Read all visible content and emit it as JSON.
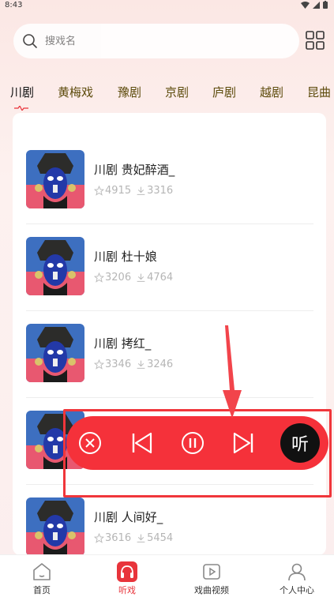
{
  "status": {
    "time": "8:43"
  },
  "search": {
    "placeholder": "搜戏名"
  },
  "tabs": [
    {
      "label": "川剧",
      "active": true
    },
    {
      "label": "黄梅戏",
      "active": false
    },
    {
      "label": "豫剧",
      "active": false
    },
    {
      "label": "京剧",
      "active": false
    },
    {
      "label": "庐剧",
      "active": false
    },
    {
      "label": "越剧",
      "active": false
    },
    {
      "label": "昆曲",
      "active": false
    }
  ],
  "items": [
    {
      "title": "川剧 贵妃醉酒_",
      "favorites": "4915",
      "downloads": "3316"
    },
    {
      "title": "川剧 杜十娘",
      "favorites": "3206",
      "downloads": "4764"
    },
    {
      "title": "川剧 拷红_",
      "favorites": "3346",
      "downloads": "3246"
    },
    {
      "title": "",
      "favorites": "",
      "downloads": ""
    },
    {
      "title": "川剧 人间好_",
      "favorites": "3616",
      "downloads": "5454"
    }
  ],
  "player": {
    "listen_label": "听",
    "accent": "#f5313a"
  },
  "nav": [
    {
      "label": "首页",
      "icon": "home-icon",
      "active": false
    },
    {
      "label": "听戏",
      "icon": "headphones-icon",
      "active": true
    },
    {
      "label": "戏曲视频",
      "icon": "video-icon",
      "active": false
    },
    {
      "label": "个人中心",
      "icon": "user-icon",
      "active": false
    }
  ],
  "colors": {
    "accent": "#e8343b",
    "tab_text": "#5d4b0c"
  }
}
